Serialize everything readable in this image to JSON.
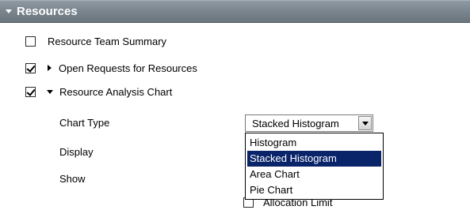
{
  "section": {
    "title": "Resources"
  },
  "items": [
    {
      "label": "Resource Team Summary",
      "checked": false
    },
    {
      "label": "Open Requests for Resources",
      "checked": true,
      "expanded": false
    },
    {
      "label": "Resource Analysis Chart",
      "checked": true,
      "expanded": true
    }
  ],
  "fields": {
    "chart_type_label": "Chart Type",
    "display_label": "Display",
    "show_label": "Show"
  },
  "select": {
    "value": "Stacked Histogram",
    "options": [
      "Histogram",
      "Stacked Histogram",
      "Area Chart",
      "Pie Chart"
    ],
    "selected_index": 1
  },
  "partial_option": {
    "label": "Allocation Limit",
    "checked": false
  },
  "colors": {
    "header": "#7b868f",
    "selection": "#0a246a"
  }
}
